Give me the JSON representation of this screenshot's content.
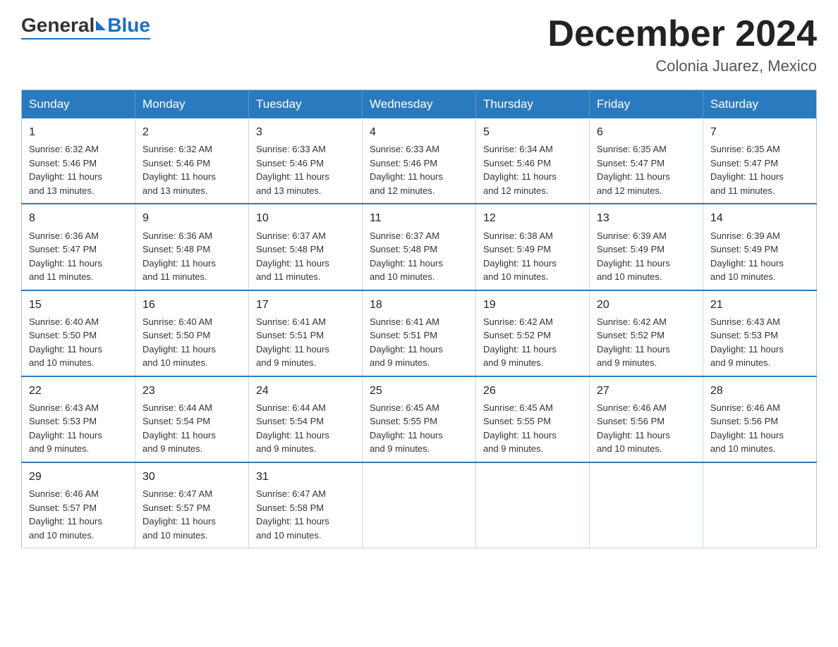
{
  "header": {
    "logo_general": "General",
    "logo_blue": "Blue",
    "month_title": "December 2024",
    "location": "Colonia Juarez, Mexico"
  },
  "days_of_week": [
    "Sunday",
    "Monday",
    "Tuesday",
    "Wednesday",
    "Thursday",
    "Friday",
    "Saturday"
  ],
  "weeks": [
    [
      {
        "day": "1",
        "sunrise": "6:32 AM",
        "sunset": "5:46 PM",
        "daylight_hours": "11",
        "daylight_minutes": "13"
      },
      {
        "day": "2",
        "sunrise": "6:32 AM",
        "sunset": "5:46 PM",
        "daylight_hours": "11",
        "daylight_minutes": "13"
      },
      {
        "day": "3",
        "sunrise": "6:33 AM",
        "sunset": "5:46 PM",
        "daylight_hours": "11",
        "daylight_minutes": "13"
      },
      {
        "day": "4",
        "sunrise": "6:33 AM",
        "sunset": "5:46 PM",
        "daylight_hours": "11",
        "daylight_minutes": "12"
      },
      {
        "day": "5",
        "sunrise": "6:34 AM",
        "sunset": "5:46 PM",
        "daylight_hours": "11",
        "daylight_minutes": "12"
      },
      {
        "day": "6",
        "sunrise": "6:35 AM",
        "sunset": "5:47 PM",
        "daylight_hours": "11",
        "daylight_minutes": "12"
      },
      {
        "day": "7",
        "sunrise": "6:35 AM",
        "sunset": "5:47 PM",
        "daylight_hours": "11",
        "daylight_minutes": "11"
      }
    ],
    [
      {
        "day": "8",
        "sunrise": "6:36 AM",
        "sunset": "5:47 PM",
        "daylight_hours": "11",
        "daylight_minutes": "11"
      },
      {
        "day": "9",
        "sunrise": "6:36 AM",
        "sunset": "5:48 PM",
        "daylight_hours": "11",
        "daylight_minutes": "11"
      },
      {
        "day": "10",
        "sunrise": "6:37 AM",
        "sunset": "5:48 PM",
        "daylight_hours": "11",
        "daylight_minutes": "11"
      },
      {
        "day": "11",
        "sunrise": "6:37 AM",
        "sunset": "5:48 PM",
        "daylight_hours": "11",
        "daylight_minutes": "10"
      },
      {
        "day": "12",
        "sunrise": "6:38 AM",
        "sunset": "5:49 PM",
        "daylight_hours": "11",
        "daylight_minutes": "10"
      },
      {
        "day": "13",
        "sunrise": "6:39 AM",
        "sunset": "5:49 PM",
        "daylight_hours": "11",
        "daylight_minutes": "10"
      },
      {
        "day": "14",
        "sunrise": "6:39 AM",
        "sunset": "5:49 PM",
        "daylight_hours": "11",
        "daylight_minutes": "10"
      }
    ],
    [
      {
        "day": "15",
        "sunrise": "6:40 AM",
        "sunset": "5:50 PM",
        "daylight_hours": "11",
        "daylight_minutes": "10"
      },
      {
        "day": "16",
        "sunrise": "6:40 AM",
        "sunset": "5:50 PM",
        "daylight_hours": "11",
        "daylight_minutes": "10"
      },
      {
        "day": "17",
        "sunrise": "6:41 AM",
        "sunset": "5:51 PM",
        "daylight_hours": "11",
        "daylight_minutes": "9"
      },
      {
        "day": "18",
        "sunrise": "6:41 AM",
        "sunset": "5:51 PM",
        "daylight_hours": "11",
        "daylight_minutes": "9"
      },
      {
        "day": "19",
        "sunrise": "6:42 AM",
        "sunset": "5:52 PM",
        "daylight_hours": "11",
        "daylight_minutes": "9"
      },
      {
        "day": "20",
        "sunrise": "6:42 AM",
        "sunset": "5:52 PM",
        "daylight_hours": "11",
        "daylight_minutes": "9"
      },
      {
        "day": "21",
        "sunrise": "6:43 AM",
        "sunset": "5:53 PM",
        "daylight_hours": "11",
        "daylight_minutes": "9"
      }
    ],
    [
      {
        "day": "22",
        "sunrise": "6:43 AM",
        "sunset": "5:53 PM",
        "daylight_hours": "11",
        "daylight_minutes": "9"
      },
      {
        "day": "23",
        "sunrise": "6:44 AM",
        "sunset": "5:54 PM",
        "daylight_hours": "11",
        "daylight_minutes": "9"
      },
      {
        "day": "24",
        "sunrise": "6:44 AM",
        "sunset": "5:54 PM",
        "daylight_hours": "11",
        "daylight_minutes": "9"
      },
      {
        "day": "25",
        "sunrise": "6:45 AM",
        "sunset": "5:55 PM",
        "daylight_hours": "11",
        "daylight_minutes": "9"
      },
      {
        "day": "26",
        "sunrise": "6:45 AM",
        "sunset": "5:55 PM",
        "daylight_hours": "11",
        "daylight_minutes": "9"
      },
      {
        "day": "27",
        "sunrise": "6:46 AM",
        "sunset": "5:56 PM",
        "daylight_hours": "11",
        "daylight_minutes": "10"
      },
      {
        "day": "28",
        "sunrise": "6:46 AM",
        "sunset": "5:56 PM",
        "daylight_hours": "11",
        "daylight_minutes": "10"
      }
    ],
    [
      {
        "day": "29",
        "sunrise": "6:46 AM",
        "sunset": "5:57 PM",
        "daylight_hours": "11",
        "daylight_minutes": "10"
      },
      {
        "day": "30",
        "sunrise": "6:47 AM",
        "sunset": "5:57 PM",
        "daylight_hours": "11",
        "daylight_minutes": "10"
      },
      {
        "day": "31",
        "sunrise": "6:47 AM",
        "sunset": "5:58 PM",
        "daylight_hours": "11",
        "daylight_minutes": "10"
      },
      null,
      null,
      null,
      null
    ]
  ],
  "labels": {
    "sunrise_prefix": "Sunrise: ",
    "sunset_prefix": "Sunset: ",
    "daylight_prefix": "Daylight: ",
    "daylight_suffix": " hours",
    "and": "and ",
    "minutes_suffix": " minutes."
  }
}
